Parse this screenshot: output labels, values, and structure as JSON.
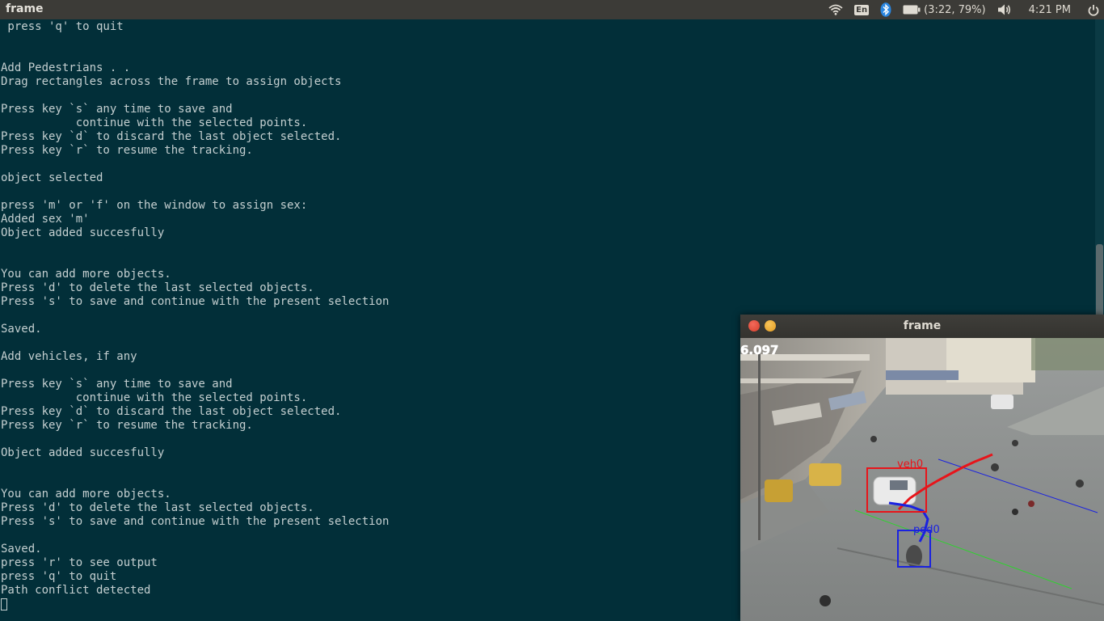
{
  "topbar": {
    "app_title": "frame",
    "keyboard_layout": "En",
    "battery_status": "(3:22, 79%)",
    "clock": "4:21 PM",
    "icons": [
      "wifi-icon",
      "keyboard-icon",
      "bluetooth-icon",
      "battery-icon",
      "volume-icon",
      "power-icon"
    ]
  },
  "terminal": {
    "lines": [
      " press 'q' to quit",
      "",
      "",
      "Add Pedestrians . .",
      "Drag rectangles across the frame to assign objects",
      "",
      "Press key `s` any time to save and",
      "           continue with the selected points.",
      "Press key `d` to discard the last object selected.",
      "Press key `r` to resume the tracking.",
      "",
      "object selected",
      "",
      "press 'm' or 'f' on the window to assign sex:",
      "Added sex 'm'",
      "Object added succesfully",
      "",
      "",
      "You can add more objects.",
      "Press 'd' to delete the last selected objects.",
      "Press 's' to save and continue with the present selection",
      "",
      "Saved.",
      "",
      "Add vehicles, if any",
      "",
      "Press key `s` any time to save and",
      "           continue with the selected points.",
      "Press key `d` to discard the last object selected.",
      "Press key `r` to resume the tracking.",
      "",
      "Object added succesfully",
      "",
      "",
      "You can add more objects.",
      "Press 'd' to delete the last selected objects.",
      "Press 's' to save and continue with the present selection",
      "",
      "Saved.",
      "press 'r' to see output",
      "press 'q' to quit",
      "Path conflict detected"
    ]
  },
  "frame_window": {
    "title": "frame",
    "overlay": {
      "counter": "6.097",
      "vehicle_label": "veh0",
      "pedestrian_label": "ped0"
    },
    "colors": {
      "vehicle": "#e8141a",
      "pedestrian": "#1a22e0",
      "green_line": "#2fd22f",
      "blue_line": "#1a22e0"
    }
  }
}
